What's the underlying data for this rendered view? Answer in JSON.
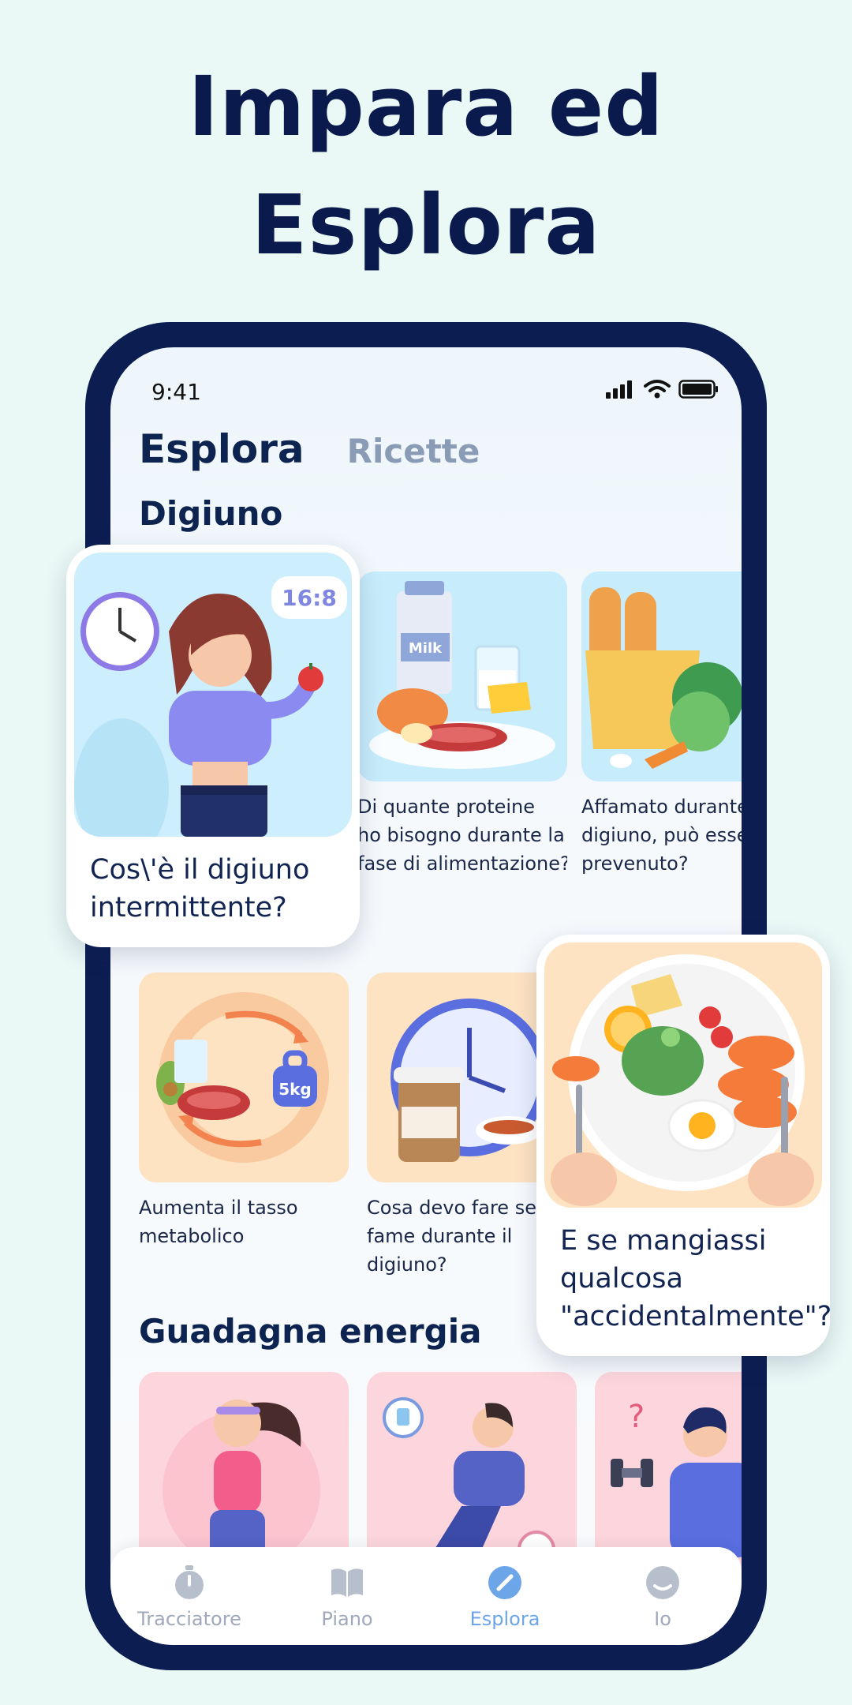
{
  "headline": {
    "line1": "Impara ed",
    "line2": "Esplora"
  },
  "status_bar": {
    "time": "9:41"
  },
  "tabs": {
    "active": "Esplora",
    "other": "Ricette"
  },
  "sections": {
    "fasting": "Digiuno",
    "energy": "Guadagna energia"
  },
  "cards_row1": [
    {
      "caption": [
        "Di quante proteine",
        "ho bisogno durante la",
        "fase di alimentazione?"
      ],
      "badge": "Milk"
    },
    {
      "caption": [
        "Affamato durante il",
        "digiuno, può essere",
        "prevenuto?"
      ]
    }
  ],
  "cards_row2": [
    {
      "caption": [
        "Aumenta il tasso",
        "metabolico"
      ],
      "badge": "5kg"
    },
    {
      "caption": [
        "Cosa devo fare se ho",
        "fame durante il",
        "digiuno?"
      ]
    }
  ],
  "float_cards": {
    "left": {
      "badge": "16:8",
      "caption": [
        "Cos\\'è il digiuno",
        "intermittente?"
      ]
    },
    "right": {
      "caption": [
        "E se mangiassi",
        "qualcosa",
        "\"accidentalmente\"?"
      ]
    }
  },
  "nav": [
    {
      "label": "Tracciatore",
      "icon": "stopwatch-icon"
    },
    {
      "label": "Piano",
      "icon": "book-icon"
    },
    {
      "label": "Esplora",
      "icon": "compass-icon",
      "active": true
    },
    {
      "label": "Io",
      "icon": "face-icon"
    }
  ],
  "colors": {
    "navy": "#0c1d52",
    "active_tab": "#6da6e8",
    "background": "#eaf8f6"
  }
}
